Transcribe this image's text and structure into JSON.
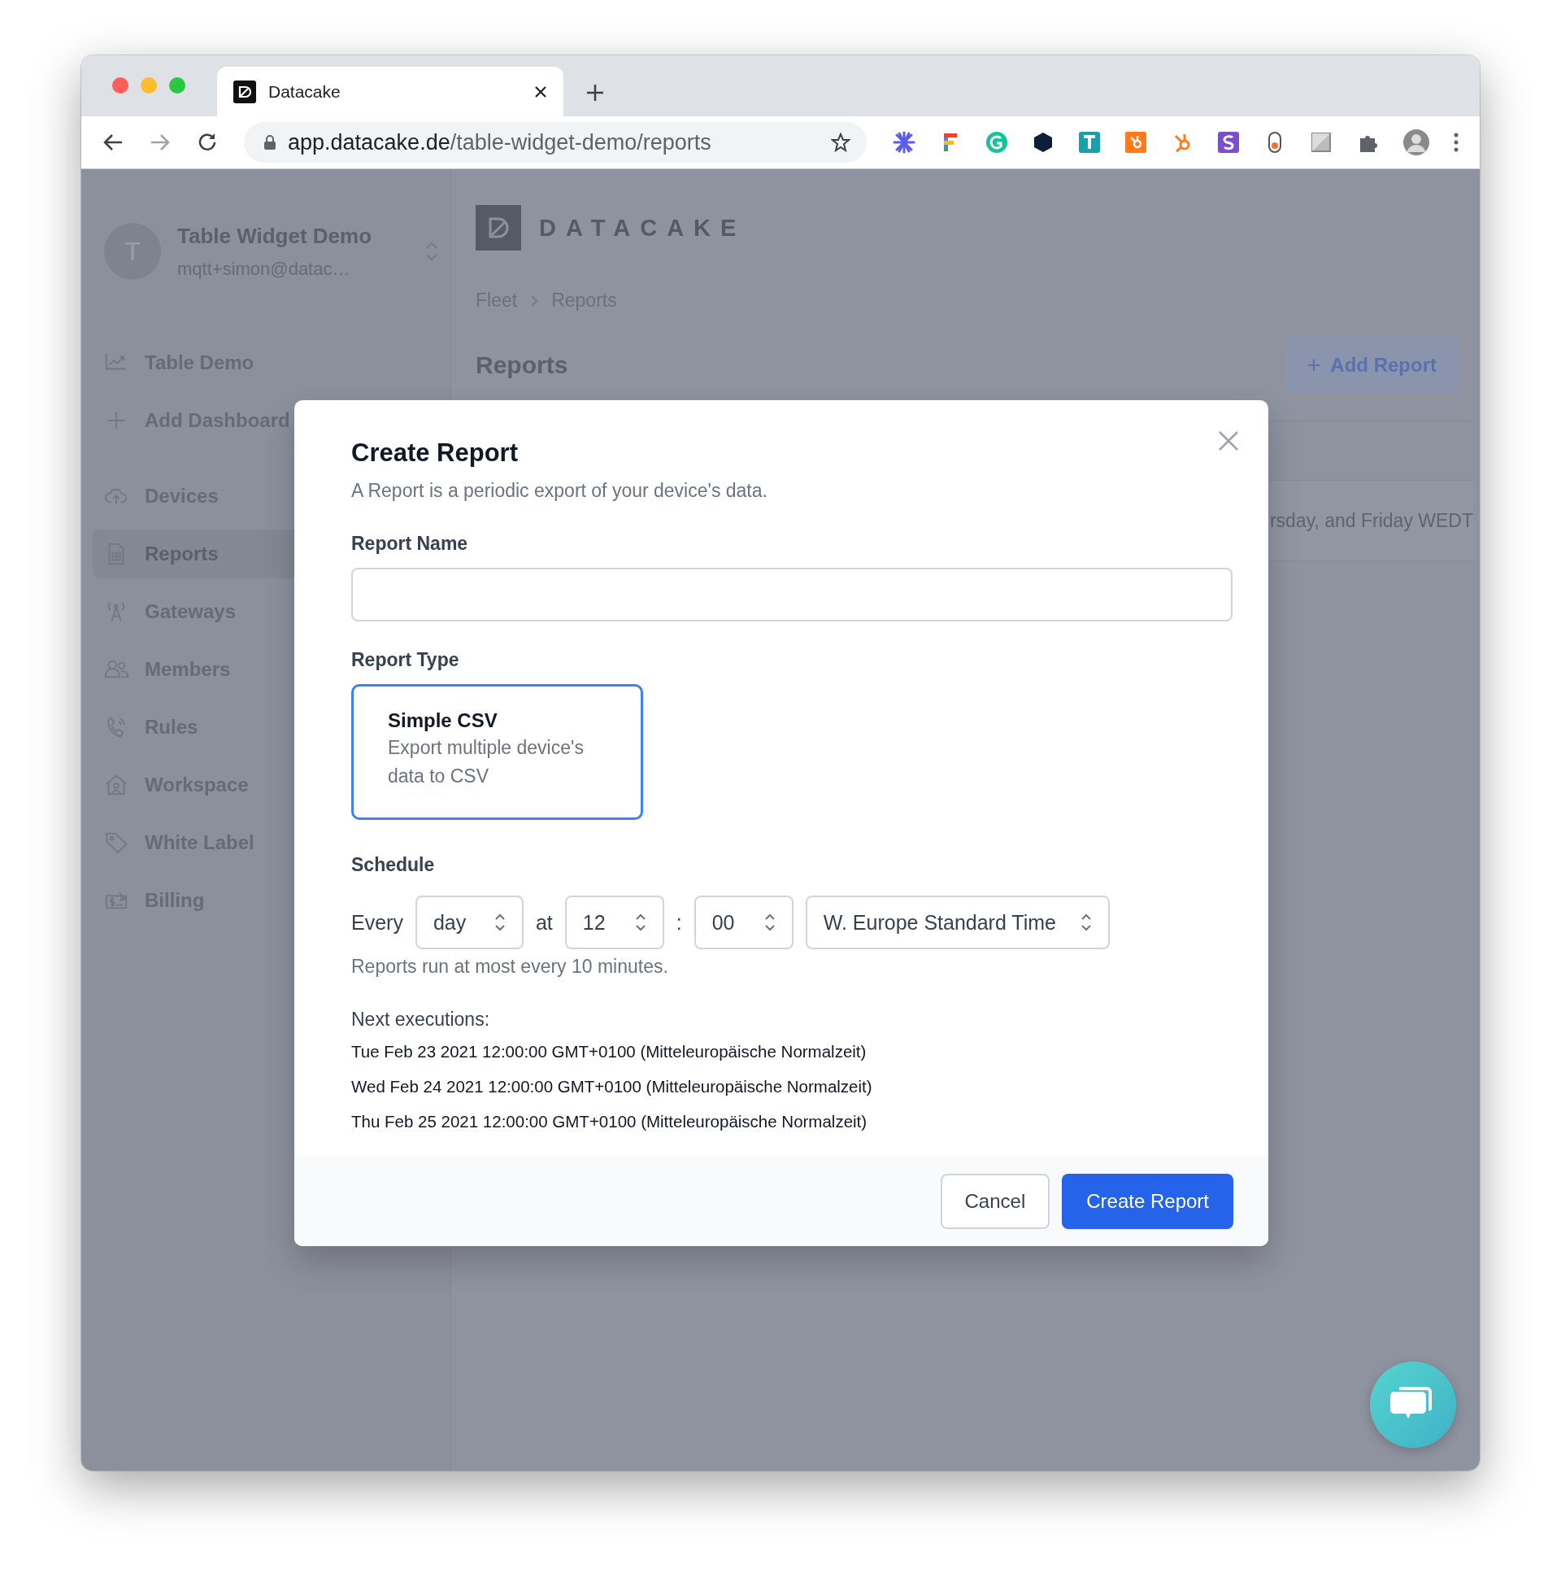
{
  "browser": {
    "tab": {
      "title": "Datacake"
    },
    "url": {
      "host": "app.datacake.de",
      "path": "/table-widget-demo/reports"
    }
  },
  "sidebar": {
    "workspace": {
      "avatar": "T",
      "name": "Table Widget Demo",
      "email": "mqtt+simon@datac…"
    },
    "items": [
      {
        "label": "Table Demo",
        "selected": false
      },
      {
        "label": "Add Dashboard",
        "selected": false
      },
      {
        "label": "Devices",
        "selected": false
      },
      {
        "label": "Reports",
        "selected": true
      },
      {
        "label": "Gateways",
        "selected": false
      },
      {
        "label": "Members",
        "selected": false
      },
      {
        "label": "Rules",
        "selected": false
      },
      {
        "label": "Workspace",
        "selected": false
      },
      {
        "label": "White Label",
        "selected": false
      },
      {
        "label": "Billing",
        "selected": false
      }
    ]
  },
  "header": {
    "logo": "DATACAKE",
    "breadcrumb": [
      "Fleet",
      "Reports"
    ],
    "title": "Reports",
    "add_button": "Add Report"
  },
  "table": {
    "rows": [
      {
        "column_1": "rsday, and Friday WEDT"
      }
    ]
  },
  "dialog": {
    "title": "Create Report",
    "description": "A Report is a periodic export of your device's data.",
    "name_label": "Report Name",
    "type_label": "Report Type",
    "types": [
      {
        "title": "Simple CSV",
        "description": "Export multiple device's data to CSV",
        "selected": true
      }
    ],
    "schedule": {
      "label": "Schedule",
      "every": "Every",
      "interval": "day",
      "at": "at",
      "hour": "12",
      "separator": ":",
      "minute": "00",
      "timezone": "W. Europe Standard Time",
      "note": "Reports run at most every 10 minutes."
    },
    "next": {
      "label": "Next executions:",
      "items": [
        "Tue Feb 23 2021 12:00:00 GMT+0100 (Mitteleuropäische Normalzeit)",
        "Wed Feb 24 2021 12:00:00 GMT+0100 (Mitteleuropäische Normalzeit)",
        "Thu Feb 25 2021 12:00:00 GMT+0100 (Mitteleuropäische Normalzeit)"
      ]
    },
    "buttons": [
      {
        "label": "Cancel",
        "kind": "secondary"
      },
      {
        "label": "Create Report",
        "kind": "primary"
      }
    ]
  }
}
